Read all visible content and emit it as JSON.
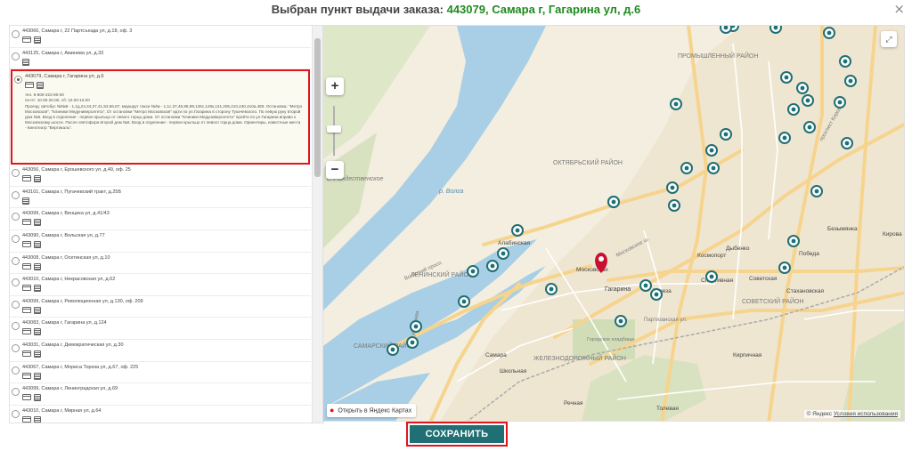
{
  "header": {
    "title": "Выбран пункт выдачи заказа:",
    "selected": "443079, Самара г, Гагарина ул, д.6",
    "close_glyph": "×"
  },
  "list": {
    "items": [
      {
        "address": "443066, Самара г, 22 Партсъезда ул, д.18, оф. 3",
        "payment": [
          "card",
          "cash"
        ]
      },
      {
        "address": "443125, Самара г, Аминева ул, д.33",
        "payment": [
          "cash"
        ]
      },
      {
        "address": "443079, Самара г, Гагарина ул, д.6",
        "payment": [
          "card",
          "cash"
        ],
        "selected": true,
        "phone": "тел. 8-800-222-80-00",
        "hours": "пн-пт: 10.00-20.00, сб: 10.00-16.00",
        "directions": "Проезд: автобус №№8 - 1,1д,24,34,37,41,53,56,67; маршрут такси №№ - 1,1с,37,46,96,99,126с,126к,131,205,210,240,410а,480. Остановка: \"Метро Московская\", \"Клиники Медуниверситета\". От остановки \"Метро Московская\" идти по ул.Гагарина в сторону Тухачевского. По левую руку второй дом №6. Вход в отделение - первое крыльцо от левого торца дома. От остановки \"Клиники Медуниверситета\" пройти по ул.Гагарина вправо к Московскому шоссе. После светофора второй дом №6. Вход в отделение - первое крыльцо от левого торца дома. Ориентиры, известные места - Кинотеатр \"Вертикаль\"."
      },
      {
        "address": "443056, Самара г, Ерошевского ул, д.49, оф. 25",
        "payment": [
          "card",
          "cash"
        ]
      },
      {
        "address": "443101, Самара г, Пугачевский тракт, д.25Б",
        "payment": [
          "cash"
        ]
      },
      {
        "address": "443099, Самара г, Венцека ул, д.41/43",
        "payment": [
          "card",
          "cash"
        ]
      },
      {
        "address": "443090, Самара г, Вольская ул, д.77",
        "payment": [
          "card",
          "cash"
        ]
      },
      {
        "address": "443008, Самара г, Осетинская ул, д.10",
        "payment": [
          "card",
          "cash"
        ]
      },
      {
        "address": "443010, Самара г, Некрасовская ул, д.62",
        "payment": [
          "card",
          "cash"
        ]
      },
      {
        "address": "443099, Самара г, Революционная ул, д.130, оф. 209",
        "payment": [
          "card",
          "cash"
        ]
      },
      {
        "address": "443083, Самара г, Гагарина ул, д.124",
        "payment": [
          "card",
          "cash"
        ]
      },
      {
        "address": "443031, Самара г, Демократическая ул, д.30",
        "payment": [
          "card",
          "cash"
        ]
      },
      {
        "address": "443067, Самара г, Мориса Тореза ул, д.67, оф. 225",
        "payment": [
          "card",
          "cash"
        ]
      },
      {
        "address": "443099, Самара г, Ленинградская ул, д.69",
        "payment": [
          "card",
          "cash"
        ]
      },
      {
        "address": "443010, Самара г, Мирная ул, д.64",
        "payment": [
          "card",
          "cash"
        ]
      }
    ]
  },
  "map": {
    "labels": {
      "district_industrial": "ПРОМЫШЛЕННЫЙ РАЙОН",
      "district_oktyabrsky": "ОКТЯБРЬСКИЙ РАЙОН",
      "district_leninsky": "ЛЕНИНСКИЙ РАЙОН",
      "district_sovetsky": "СОВЕТСКИЙ РАЙОН",
      "district_samarsky": "САМАРСКИЙ РАЙОН",
      "district_railway": "ЖЕЛЕЗНОДОРОЖНЫЙ РАЙОН",
      "river_volga": "р. Волга",
      "rozhdestvenskoe": "с. Рождественское",
      "st_moskovskaya": "Московская",
      "st_alabinskaya": "Алабинская",
      "st_gagarina": "Гагарина",
      "st_sportivnaya": "Спортивная",
      "st_sovetskaya": "Советская",
      "st_pobeda": "Победа",
      "st_bezymyanka": "Безымянка",
      "st_kirova": "Кирова",
      "st_samara": "Самара",
      "st_tolevaya": "Толевая",
      "st_rechnaya": "Речная",
      "st_stakhanovskaya": "Стахановская",
      "st_kirpichnaya": "Кирпичная",
      "st_shkolnaya": "Школьная",
      "st_kosmoport": "Космопорт",
      "st_dubenko": "Дыбенко",
      "cemetery": "Городское кладбище",
      "sq_toreza": "Тореза",
      "st_gagarina_sq": "Гагарина",
      "ave_moskovskoe": "Московское ш.",
      "ave_kirova": "проспект Кирова",
      "ave_gagarina": "ул. Гагарина",
      "ave_volzhsky": "Волжский просп.",
      "ave_kuybysheva": "ул. Куйбышева",
      "ave_partizanskaya": "Партизанская ул."
    },
    "open_yandex": "Открыть в Яндекс Картах",
    "copyright": "© Яндекс",
    "terms": "Условия использования",
    "zoom_in": "+",
    "zoom_out": "−",
    "fullscreen_glyph": "⤢",
    "marker_color": "#1f6f74",
    "selected_color": "#c8102e"
  },
  "save_button": "СОХРАНИТЬ"
}
